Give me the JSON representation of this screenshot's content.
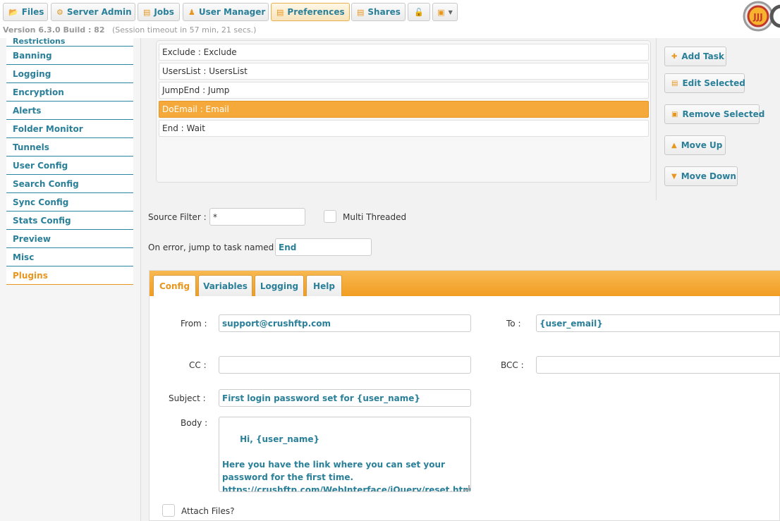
{
  "nav": {
    "files": "Files",
    "server_admin": "Server Admin",
    "jobs": "Jobs",
    "user_manager": "User Manager",
    "preferences": "Preferences",
    "shares": "Shares",
    "version_label": "Version 6.3.0 Build : 82",
    "session_timeout": "(Session timeout in 57 min, 21 secs.)"
  },
  "sidebar": {
    "items": [
      {
        "label": "Restrictions"
      },
      {
        "label": "Banning"
      },
      {
        "label": "Logging"
      },
      {
        "label": "Encryption"
      },
      {
        "label": "Alerts"
      },
      {
        "label": "Folder Monitor"
      },
      {
        "label": "Tunnels"
      },
      {
        "label": "User Config"
      },
      {
        "label": "Search Config"
      },
      {
        "label": "Sync Config"
      },
      {
        "label": "Stats Config"
      },
      {
        "label": "Preview"
      },
      {
        "label": "Misc"
      },
      {
        "label": "Plugins"
      }
    ],
    "active": "Plugins"
  },
  "tasks": [
    {
      "label": "Exclude : Exclude"
    },
    {
      "label": "UsersList : UsersList"
    },
    {
      "label": "JumpEnd : Jump"
    },
    {
      "label": "DoEmail : Email"
    },
    {
      "label": "End : Wait"
    }
  ],
  "task_actions": {
    "add": "Add Task",
    "edit": "Edit Selected",
    "remove": "Remove Selected",
    "up": "Move Up",
    "down": "Move Down"
  },
  "task_settings": {
    "source_filter_label": "Source Filter :",
    "source_filter_value": "*",
    "multi_threaded_label": "Multi Threaded",
    "on_error_label": "On error, jump to task named :",
    "on_error_value": "End"
  },
  "tabs": {
    "config": "Config",
    "variables": "Variables",
    "logging": "Logging",
    "help": "Help"
  },
  "email": {
    "from_label": "From :",
    "from_value": "support@crushftp.com",
    "to_label": "To :",
    "to_value": "{user_email}",
    "cc_label": "CC :",
    "cc_value": "",
    "bcc_label": "BCC :",
    "bcc_value": "",
    "subject_label": "Subject :",
    "subject_value": "First login password set for {user_name}",
    "body_label": "Body :",
    "body_value": "Hi, {user_name}\n\nHere you have the link where you can set your password for the first time.\nhttps://crushftp.com/WebInterface/jQuery/reset.html",
    "attach_label": "Attach Files?"
  }
}
